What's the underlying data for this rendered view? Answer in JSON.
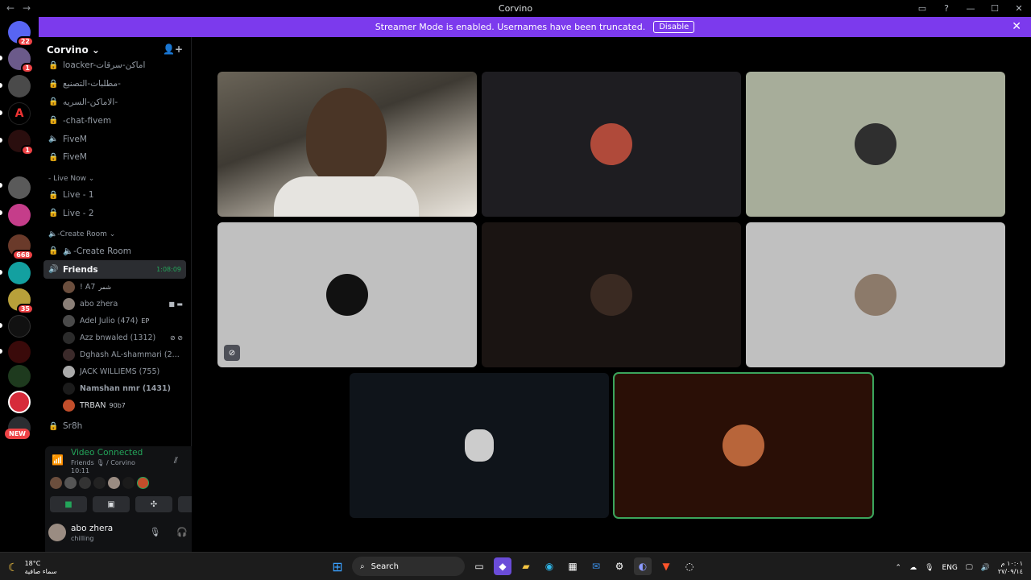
{
  "window": {
    "title": "Corvino",
    "controls": [
      "▭",
      "?",
      "—",
      "☐",
      "✕"
    ]
  },
  "banner": {
    "text": "Streamer Mode is enabled. Usernames have been truncated.",
    "disable_label": "Disable"
  },
  "servers": {
    "badges": {
      "home": "22",
      "s1": "1",
      "s4": "1",
      "s8": "668",
      "s10": "35"
    },
    "new_label": "NEW"
  },
  "guild": {
    "name": "Corvino ⌄"
  },
  "channels": [
    {
      "name": "loacker-اماكن-سرقات",
      "icon": "🔒"
    },
    {
      "name": "مطلبات-التصنيع-",
      "icon": "🔒"
    },
    {
      "name": "الاماكن-السريه-",
      "icon": "🔒"
    },
    {
      "name": "-chat-fivem",
      "icon": "🔒"
    },
    {
      "name": "FiveM",
      "icon": "🔈"
    },
    {
      "name": "FiveM",
      "icon": "🔒"
    }
  ],
  "categories": {
    "live_now": "- Live Now ⌄",
    "create_room": "🔈-Create Room ⌄"
  },
  "live_channels": [
    {
      "name": "Live - 1"
    },
    {
      "name": "Live - 2"
    }
  ],
  "create_room_channel": {
    "name": "🔈-Create Room"
  },
  "voice_channel": {
    "name": "Friends",
    "time": "1:08:09"
  },
  "members": [
    {
      "name": "! A7",
      "tag": "شمر",
      "color": "#6b4e3d"
    },
    {
      "name": "abo zhera",
      "tag": "",
      "color": "#8a7f77"
    },
    {
      "name": "Adel Julio (474)",
      "tag": "EP",
      "color": "#4a4a4a"
    },
    {
      "name": "Azz bnwaled (1312)",
      "tag": "",
      "color": "#2b2b2b"
    },
    {
      "name": "Dghash AL-shammari (2...",
      "tag": "",
      "color": "#3b2a2a"
    },
    {
      "name": "JACK WILLIEMS (755)",
      "tag": "",
      "color": "#aaaaaa"
    },
    {
      "name": "Namshan nmr (1431)",
      "tag": "",
      "color": "#1b1b1b"
    },
    {
      "name": "TRBAN",
      "tag": "90b7",
      "color": "#c24e2b"
    }
  ],
  "last_channel": {
    "name": "Sr8h"
  },
  "voice_panel": {
    "status": "Video Connected",
    "channel": "Friends 🎙 / Corvino",
    "timer": "10:11"
  },
  "user": {
    "name": "abo zhera",
    "status": "chilling"
  },
  "taskbar": {
    "temp": "18°C",
    "weather": "سماء صافية",
    "search_placeholder": "Search",
    "lang": "ENG",
    "time": "١٠:٠١ م",
    "date": "٢٧/٠٩/١٤"
  }
}
